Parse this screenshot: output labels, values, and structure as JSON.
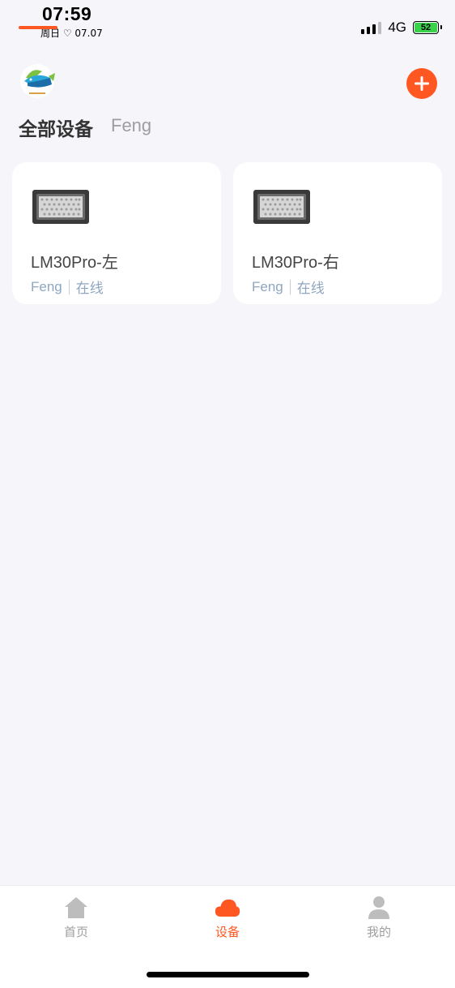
{
  "status_bar": {
    "time": "07:59",
    "date": "周日 ♡ 07.07",
    "network": "4G",
    "battery": "52"
  },
  "header": {
    "logo_icon": "fish-logo-icon",
    "add_icon": "plus-icon",
    "accent_color": "#ff5722"
  },
  "tabs": [
    {
      "label": "全部设备",
      "active": true
    },
    {
      "label": "Feng",
      "active": false
    }
  ],
  "devices": [
    {
      "name": "LM30Pro-左",
      "group": "Feng",
      "status": "在线"
    },
    {
      "name": "LM30Pro-右",
      "group": "Feng",
      "status": "在线"
    }
  ],
  "bottom_nav": [
    {
      "label": "首页",
      "icon": "home-icon",
      "active": false
    },
    {
      "label": "设备",
      "icon": "cloud-icon",
      "active": true
    },
    {
      "label": "我的",
      "icon": "user-icon",
      "active": false
    }
  ]
}
